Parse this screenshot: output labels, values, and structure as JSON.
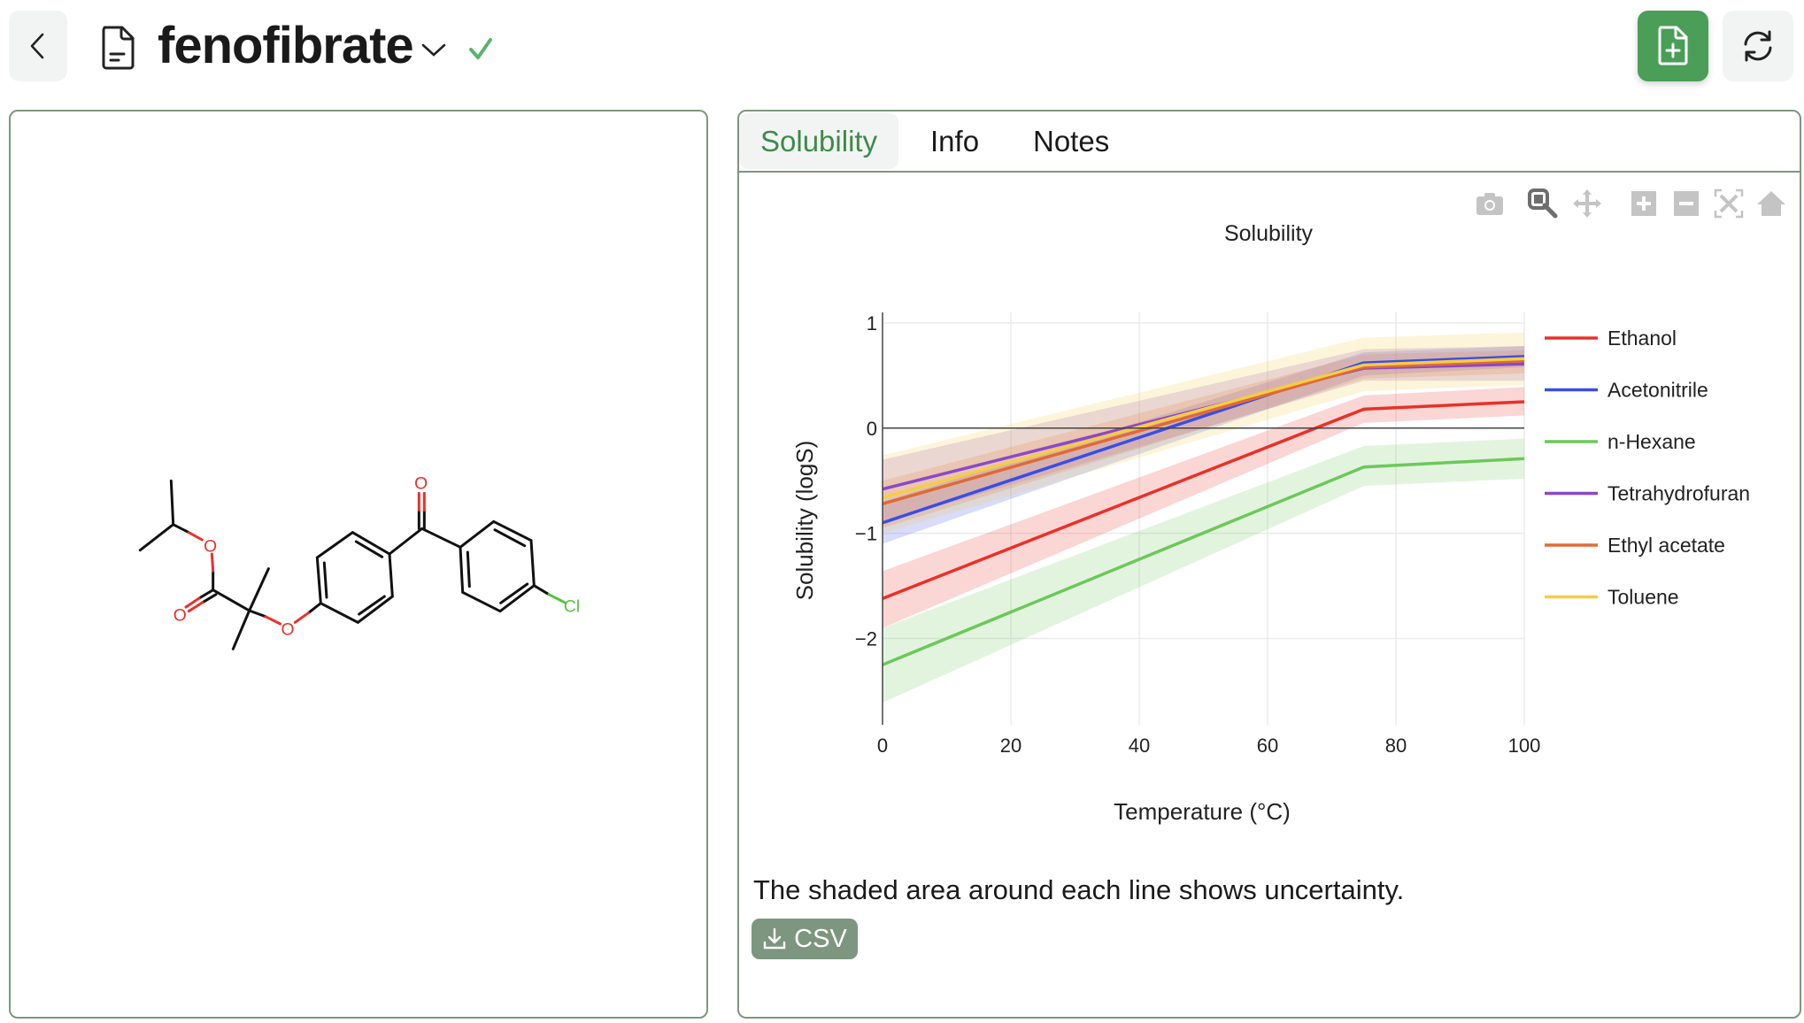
{
  "header": {
    "title": "fenofibrate",
    "saved_status_icon": "check-icon",
    "icons": [
      "chevron-left-icon",
      "document-icon",
      "chevron-down-icon",
      "check-icon",
      "file-plus-icon",
      "refresh-icon"
    ],
    "accent_color": "#4a9e57"
  },
  "molecule": {
    "atom_labels": {
      "oxygen": "O",
      "chlorine": "Cl"
    }
  },
  "tabs": [
    {
      "label": "Solubility",
      "active": true
    },
    {
      "label": "Info",
      "active": false
    },
    {
      "label": "Notes",
      "active": false
    }
  ],
  "modebar": [
    "camera-icon",
    "zoom-icon",
    "pan-icon",
    "zoom-in-icon",
    "zoom-out-icon",
    "autoscale-icon",
    "home-icon"
  ],
  "note": "The shaded area around each line shows uncertainty.",
  "csv_button": {
    "label": "CSV",
    "icon": "download-icon"
  },
  "chart_data": {
    "type": "line",
    "title": "Solubility",
    "xlabel": "Temperature (°C)",
    "ylabel": "Solubility (logS)",
    "xlim": [
      0,
      100
    ],
    "ylim": [
      -2.82,
      1.1
    ],
    "xticks": [
      "0",
      "20",
      "40",
      "60",
      "80",
      "100"
    ],
    "yticks": [
      "1",
      "0",
      "−1",
      "−2"
    ],
    "ytick_values": [
      1,
      0,
      -1,
      -2
    ],
    "xtick_values": [
      0,
      20,
      40,
      60,
      80,
      100
    ],
    "grid": true,
    "legend_position": "right",
    "x": [
      0,
      75,
      100
    ],
    "series": [
      {
        "name": "Ethanol",
        "color": "#e8312a",
        "values": [
          -1.62,
          0.18,
          0.25
        ],
        "lower": [
          -1.9,
          0.05,
          0.12
        ],
        "upper": [
          -1.36,
          0.31,
          0.39
        ]
      },
      {
        "name": "Acetonitrile",
        "color": "#3a4de8",
        "values": [
          -0.9,
          0.62,
          0.68
        ],
        "lower": [
          -1.1,
          0.5,
          0.58
        ],
        "upper": [
          -0.7,
          0.72,
          0.78
        ]
      },
      {
        "name": "n-Hexane",
        "color": "#6cc85a",
        "values": [
          -2.25,
          -0.37,
          -0.29
        ],
        "lower": [
          -2.61,
          -0.55,
          -0.48
        ],
        "upper": [
          -1.9,
          -0.17,
          -0.1
        ]
      },
      {
        "name": "Tetrahydrofuran",
        "color": "#8c48c8",
        "values": [
          -0.58,
          0.57,
          0.61
        ],
        "lower": [
          -0.9,
          0.45,
          0.45
        ],
        "upper": [
          -0.3,
          0.75,
          0.78
        ]
      },
      {
        "name": "Ethyl acetate",
        "color": "#e06a35",
        "values": [
          -0.72,
          0.58,
          0.64
        ],
        "lower": [
          -0.95,
          0.47,
          0.52
        ],
        "upper": [
          -0.5,
          0.7,
          0.74
        ]
      },
      {
        "name": "Toluene",
        "color": "#f5cc45",
        "values": [
          -0.66,
          0.6,
          0.66
        ],
        "lower": [
          -1.0,
          0.35,
          0.41
        ],
        "upper": [
          -0.26,
          0.86,
          0.91
        ]
      }
    ]
  }
}
